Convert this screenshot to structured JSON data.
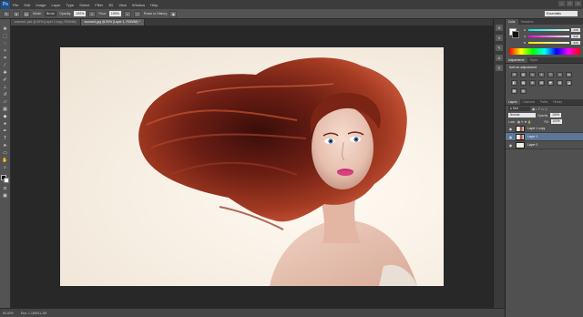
{
  "app": {
    "logo": "Ps"
  },
  "menu": [
    "File",
    "Edit",
    "Image",
    "Layer",
    "Type",
    "Select",
    "Filter",
    "3D",
    "View",
    "Window",
    "Help"
  ],
  "window_controls": [
    "–",
    "□",
    "×"
  ],
  "options_bar": {
    "mode_label": "Mode:",
    "mode_value": "Brush",
    "opacity_label": "Opacity:",
    "opacity_value": "100%",
    "flow_label": "Flow:",
    "flow_value": "100%",
    "erase_label": "Erase to History",
    "workspace": "Essentials"
  },
  "tabs": [
    {
      "label": "woman1.psd @ 49% (Layer 1 copy, RGB/8#)",
      "active": false
    },
    {
      "label": "woman1.jpg @ 50% (Layer 1, RGB/8#) *",
      "active": true
    }
  ],
  "status": {
    "zoom": "50.02%",
    "doc": "Doc: 1.10M/11.2M"
  },
  "color_panel": {
    "tabs": [
      "Color",
      "Swatches"
    ],
    "sliders": [
      {
        "label": "R",
        "value": "236"
      },
      {
        "label": "G",
        "value": "236"
      },
      {
        "label": "B",
        "value": "236"
      }
    ],
    "fg_color": "#ffffff",
    "bg_color": "#111111"
  },
  "adjustments_panel": {
    "tabs": [
      "Adjustments",
      "Styles"
    ],
    "title": "Add an adjustment",
    "icons": [
      "brightness-icon",
      "levels-icon",
      "curves-icon",
      "exposure-icon",
      "vibrance-icon",
      "hue-icon",
      "balance-icon",
      "bw-icon",
      "photo-filter-icon",
      "mixer-icon",
      "lookup-icon",
      "invert-icon",
      "posterize-icon",
      "threshold-icon",
      "gradient-map-icon",
      "selective-color-icon"
    ]
  },
  "layers_panel": {
    "tabs": [
      "Layers",
      "Channels",
      "Paths",
      "History"
    ],
    "kind_value": "ρ Kind",
    "blend_mode": "Normal",
    "opacity_label": "Opacity:",
    "opacity_value": "100%",
    "lock_label": "Lock:",
    "fill_label": "Fill:",
    "fill_value": "100%",
    "layers": [
      {
        "name": "Layer 1 copy",
        "selected": false
      },
      {
        "name": "Layer 1",
        "selected": true
      },
      {
        "name": "Layer 0",
        "selected": false
      }
    ]
  }
}
